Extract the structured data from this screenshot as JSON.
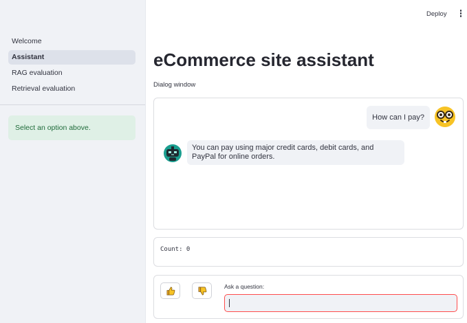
{
  "sidebar": {
    "items": [
      {
        "label": "Welcome",
        "active": false
      },
      {
        "label": "Assistant",
        "active": true
      },
      {
        "label": "RAG evaluation",
        "active": false
      },
      {
        "label": "Retrieval evaluation",
        "active": false
      }
    ],
    "info": "Select an option above."
  },
  "header": {
    "deploy_label": "Deploy",
    "menu_icon": "vertical-dots-icon"
  },
  "main": {
    "title": "eCommerce site assistant",
    "subtitle": "Dialog window",
    "messages": [
      {
        "role": "user",
        "text": "How can I pay?",
        "avatar": "nerd-face-icon"
      },
      {
        "role": "assistant",
        "text": "You can pay using major credit cards, debit cards, and PayPal for online orders.",
        "avatar": "robot-icon"
      }
    ],
    "count_text": "Count: 0",
    "feedback": {
      "up_icon": "thumbs-up-icon",
      "down_icon": "thumbs-down-icon"
    },
    "ask_label": "Ask a question:",
    "ask_value": ""
  },
  "colors": {
    "sidebar_bg": "#f0f2f6",
    "active_item_bg": "#dde1ea",
    "info_bg": "#dff0e6",
    "info_text": "#1f6b3a",
    "input_focus_border": "#ff4b4b"
  }
}
